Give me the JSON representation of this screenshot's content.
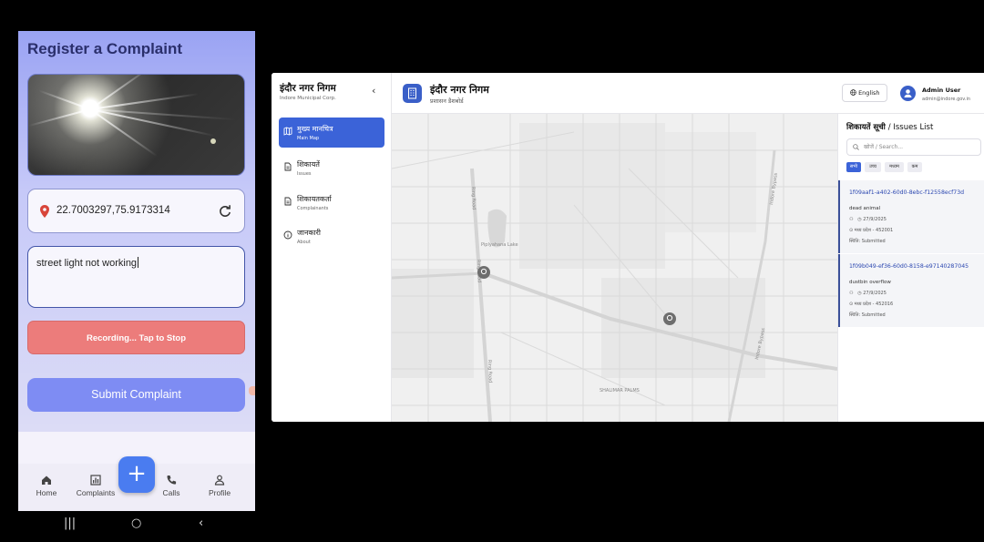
{
  "phone": {
    "title": "Register a Complaint",
    "location": "22.7003297,75.9173314",
    "description": "street light not working",
    "recording_label": "Recording... Tap to Stop",
    "submit_label": "Submit Complaint",
    "nav": [
      {
        "label": "Home",
        "icon": "home-icon"
      },
      {
        "label": "Complaints",
        "icon": "chart-icon"
      },
      {
        "label": "Calls",
        "icon": "phone-icon"
      },
      {
        "label": "Profile",
        "icon": "person-icon"
      }
    ],
    "fab_label": "+",
    "system_nav": [
      "|||",
      "○",
      "‹"
    ],
    "colors": {
      "primary": "#7e8cf3",
      "recording": "#ec7c7b",
      "fab": "#4a7cf0"
    }
  },
  "dashboard": {
    "sidebar": {
      "title": "इंदौर नगर निगम",
      "subtitle": "Indore Municipal Corp.",
      "items": [
        {
          "label": "मुख्य मानचित्र",
          "sub": "Main Map",
          "active": true
        },
        {
          "label": "शिकायतें",
          "sub": "Issues"
        },
        {
          "label": "शिकायतकर्ता",
          "sub": "Complainants"
        },
        {
          "label": "जानकारी",
          "sub": "About"
        }
      ]
    },
    "header": {
      "title": "इंदौर नगर निगम",
      "subtitle": "प्रशासन डैशबोर्ड",
      "language": "English",
      "user_name": "Admin User",
      "user_email": "admin@indore.gov.in"
    },
    "map": {
      "labels": [
        "Ring Road",
        "Piplyahana Lake",
        "Ring Road",
        "Ring Road",
        "Indore Bypass",
        "Indore Bypass",
        "SHALIMAR PALMS"
      ]
    },
    "issues": {
      "title_hi": "शिकायतें सूची",
      "title_en": "/ Issues List",
      "search_placeholder": "खोजें / Search...",
      "filters": [
        "सभी",
        "उच्च",
        "मध्यम",
        "कम"
      ],
      "list": [
        {
          "id": "1f09aaf1-a402-60d0-8ebc-f12558ecf73d",
          "type": "dead animal",
          "date": "27/9/2025",
          "location": "मध्य प्रदेश - 452001",
          "status": "स्थिति: Submitted"
        },
        {
          "id": "1f09b049-ef36-60d0-8158-e97140287045",
          "type": "dustbin overflow",
          "date": "27/9/2025",
          "location": "मध्य प्रदेश - 452016",
          "status": "स्थिति: Submitted"
        }
      ]
    }
  }
}
